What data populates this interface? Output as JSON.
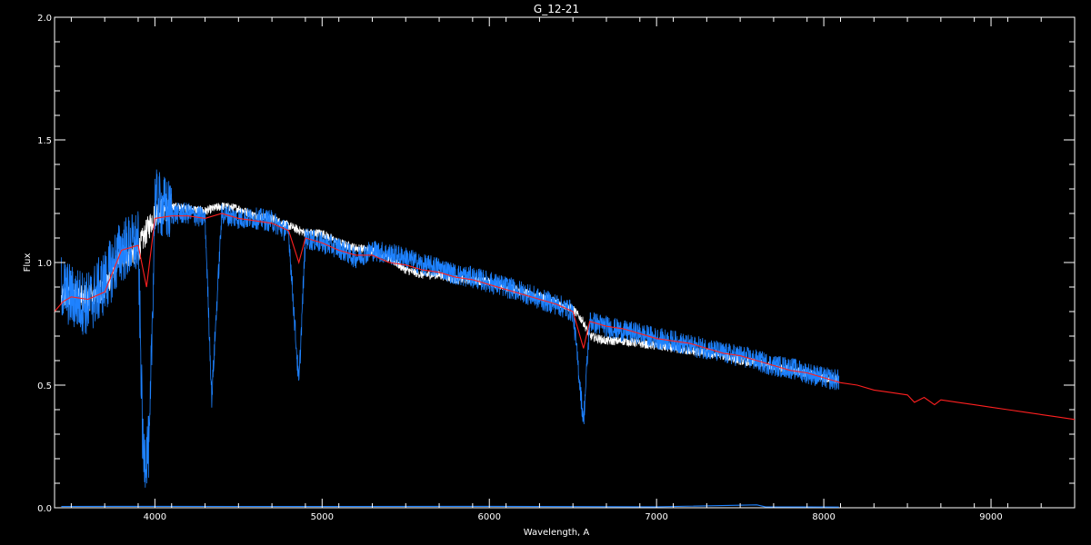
{
  "chart_data": {
    "type": "line",
    "title": "G_12-21",
    "xlabel": "Wavelength, A",
    "ylabel": "Flux",
    "xlim": [
      3400,
      9500
    ],
    "ylim": [
      0.0,
      2.0
    ],
    "grid": false,
    "background": "#000000",
    "x_ticks": [
      4000,
      5000,
      6000,
      7000,
      8000,
      9000
    ],
    "x_tick_labels": [
      "4000",
      "5000",
      "6000",
      "7000",
      "8000",
      "9000"
    ],
    "y_ticks": [
      0.0,
      0.5,
      1.0,
      1.5,
      2.0
    ],
    "y_tick_labels": [
      "0.0",
      "0.5",
      "1.0",
      "1.5",
      "2.0"
    ],
    "series": [
      {
        "color": "#ffffff",
        "noise": 0.018,
        "x": [
          3440,
          3500,
          3600,
          3700,
          3800,
          3900,
          4000,
          4100,
          4200,
          4300,
          4400,
          4500,
          4600,
          4700,
          4800,
          4900,
          5000,
          5100,
          5200,
          5300,
          5440,
          5500,
          5600,
          5700,
          5800,
          5900,
          6000,
          6100,
          6200,
          6300,
          6400,
          6500,
          6560,
          6600,
          6700,
          6800,
          6900,
          7000,
          7100,
          7200,
          7300,
          7400,
          7500,
          7600,
          7700,
          7800,
          7900,
          8000,
          8090
        ],
        "y": [
          0.85,
          0.87,
          0.85,
          0.9,
          1.02,
          1.05,
          1.2,
          1.23,
          1.22,
          1.21,
          1.23,
          1.22,
          1.19,
          1.18,
          1.15,
          1.12,
          1.12,
          1.08,
          1.06,
          1.05,
          1.0,
          0.97,
          0.95,
          0.95,
          0.93,
          0.93,
          0.92,
          0.9,
          0.88,
          0.86,
          0.84,
          0.81,
          0.76,
          0.7,
          0.68,
          0.68,
          0.67,
          0.66,
          0.65,
          0.64,
          0.63,
          0.62,
          0.6,
          0.59,
          0.58,
          0.56,
          0.55,
          0.53,
          0.52
        ]
      },
      {
        "color": "#1e82ff",
        "noise": 0.045,
        "x": [
          3440,
          3500,
          3600,
          3700,
          3800,
          3900,
          3930,
          3968,
          4000,
          4100,
          4200,
          4300,
          4340,
          4400,
          4500,
          4600,
          4700,
          4800,
          4861,
          4900,
          5000,
          5100,
          5200,
          5300,
          5440,
          5500,
          5600,
          5700,
          5800,
          5900,
          6000,
          6100,
          6200,
          6300,
          6400,
          6500,
          6563,
          6600,
          6700,
          6800,
          6900,
          7000,
          7100,
          7200,
          7300,
          7400,
          7500,
          7600,
          7700,
          7800,
          7900,
          8000,
          8090
        ],
        "y": [
          0.9,
          0.86,
          0.83,
          0.92,
          1.05,
          1.08,
          0.2,
          0.25,
          1.25,
          1.2,
          1.2,
          1.18,
          0.45,
          1.2,
          1.18,
          1.18,
          1.17,
          1.12,
          0.5,
          1.1,
          1.08,
          1.06,
          1.02,
          1.05,
          1.03,
          1.02,
          0.99,
          0.98,
          0.95,
          0.94,
          0.92,
          0.9,
          0.88,
          0.85,
          0.83,
          0.8,
          0.35,
          0.76,
          0.74,
          0.72,
          0.71,
          0.69,
          0.68,
          0.66,
          0.65,
          0.63,
          0.62,
          0.6,
          0.58,
          0.57,
          0.55,
          0.53,
          0.52
        ]
      },
      {
        "color": "#ff2020",
        "noise": 0,
        "x": [
          3400,
          3450,
          3500,
          3600,
          3700,
          3800,
          3900,
          3950,
          4000,
          4100,
          4200,
          4300,
          4400,
          4500,
          4600,
          4700,
          4800,
          4861,
          4900,
          5000,
          5100,
          5200,
          5300,
          5400,
          5500,
          5600,
          5700,
          5800,
          5900,
          6000,
          6100,
          6200,
          6300,
          6400,
          6500,
          6563,
          6600,
          6700,
          6800,
          6900,
          7000,
          7100,
          7200,
          7300,
          7400,
          7500,
          7600,
          7700,
          7800,
          7900,
          8000,
          8100,
          8200,
          8300,
          8400,
          8500,
          8542,
          8600,
          8662,
          8700,
          8800,
          8900,
          9000,
          9100,
          9200,
          9300,
          9400,
          9500
        ],
        "y": [
          0.8,
          0.84,
          0.86,
          0.85,
          0.88,
          1.05,
          1.07,
          0.9,
          1.18,
          1.19,
          1.19,
          1.18,
          1.2,
          1.18,
          1.17,
          1.16,
          1.13,
          1.0,
          1.1,
          1.08,
          1.05,
          1.03,
          1.03,
          1.0,
          0.99,
          0.97,
          0.96,
          0.94,
          0.93,
          0.91,
          0.89,
          0.87,
          0.85,
          0.83,
          0.8,
          0.65,
          0.76,
          0.74,
          0.73,
          0.71,
          0.69,
          0.68,
          0.67,
          0.65,
          0.63,
          0.62,
          0.6,
          0.58,
          0.56,
          0.55,
          0.53,
          0.51,
          0.5,
          0.48,
          0.47,
          0.46,
          0.43,
          0.45,
          0.42,
          0.44,
          0.43,
          0.42,
          0.41,
          0.4,
          0.39,
          0.38,
          0.37,
          0.36
        ]
      },
      {
        "color": "#1e82ff",
        "noise": 0,
        "x": [
          3440,
          4000,
          5000,
          6000,
          7000,
          7600,
          7650,
          8090
        ],
        "y": [
          0.005,
          0.006,
          0.005,
          0.006,
          0.004,
          0.012,
          0.004,
          0.003
        ]
      }
    ]
  }
}
